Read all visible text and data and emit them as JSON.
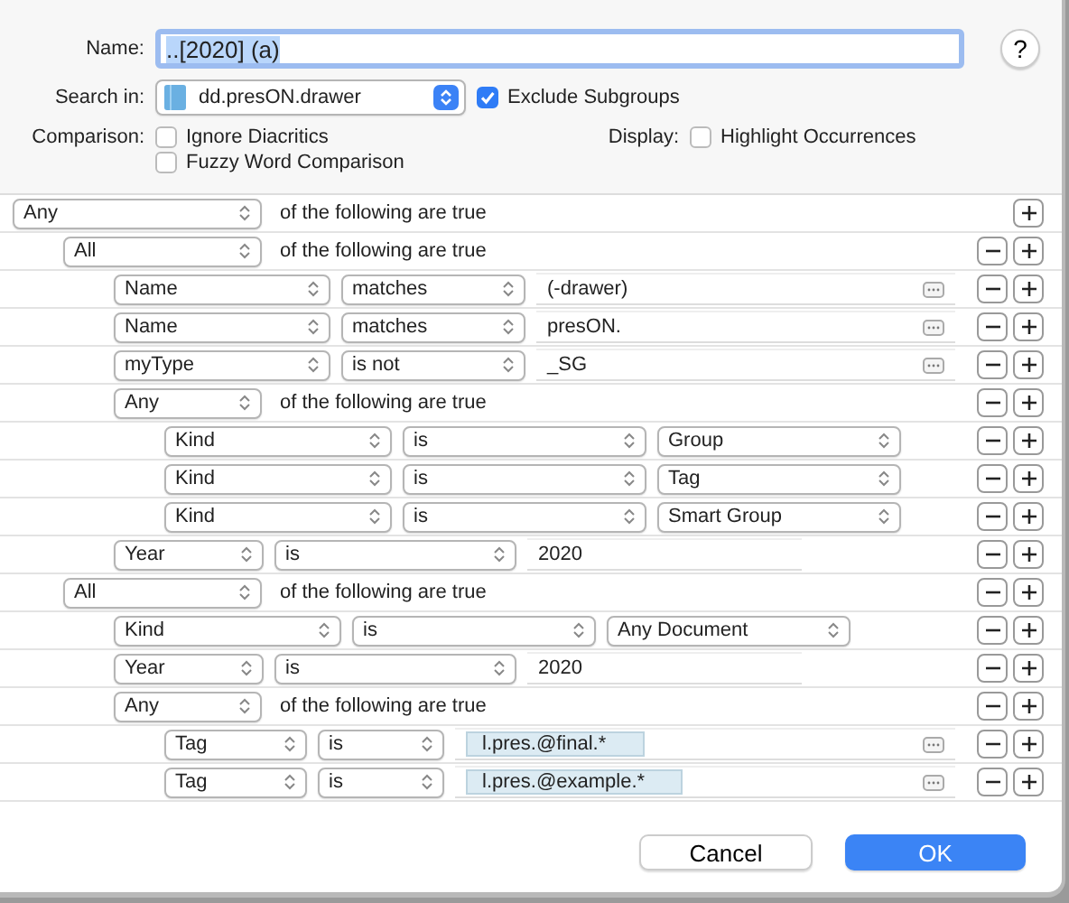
{
  "name": {
    "label": "Name:",
    "value": "..[2020] (a)"
  },
  "help": "?",
  "search_in": {
    "label": "Search in:",
    "value": "dd.presON.drawer"
  },
  "exclude_subgroups": {
    "label": "Exclude Subgroups",
    "checked": true
  },
  "comparison": {
    "label": "Comparison:",
    "options": [
      {
        "label": "Ignore Diacritics",
        "checked": false
      },
      {
        "label": "Fuzzy Word Comparison",
        "checked": false
      }
    ]
  },
  "display": {
    "label": "Display:",
    "options": [
      {
        "label": "Highlight Occurrences",
        "checked": false
      }
    ]
  },
  "rules": {
    "kind": "group",
    "quantifier": "Any",
    "suffix": "of the following are true",
    "children": [
      {
        "kind": "group",
        "quantifier": "All",
        "suffix": "of the following are true",
        "children": [
          {
            "kind": "text",
            "field": "Name",
            "operator": "matches",
            "value": "(-drawer)"
          },
          {
            "kind": "text",
            "field": "Name",
            "operator": "matches",
            "value": "presON."
          },
          {
            "kind": "text",
            "field": "myType",
            "operator": "is not",
            "value": "_SG"
          },
          {
            "kind": "group",
            "quantifier": "Any",
            "suffix": "of the following are true",
            "children": [
              {
                "kind": "choice",
                "field": "Kind",
                "operator": "is",
                "value": "Group"
              },
              {
                "kind": "choice",
                "field": "Kind",
                "operator": "is",
                "value": "Tag"
              },
              {
                "kind": "choice",
                "field": "Kind",
                "operator": "is",
                "value": "Smart Group"
              }
            ]
          },
          {
            "kind": "plain",
            "field": "Year",
            "operator": "is",
            "value": "2020"
          }
        ]
      },
      {
        "kind": "group",
        "quantifier": "All",
        "suffix": "of the following are true",
        "children": [
          {
            "kind": "choice",
            "field": "Kind",
            "operator": "is",
            "value": "Any Document"
          },
          {
            "kind": "plain",
            "field": "Year",
            "operator": "is",
            "value": "2020"
          },
          {
            "kind": "group",
            "quantifier": "Any",
            "suffix": "of the following are true",
            "children": [
              {
                "kind": "tokens",
                "field": "Tag",
                "operator": "is",
                "tokens": [
                  "l.pres.@final.*"
                ]
              },
              {
                "kind": "tokens",
                "field": "Tag",
                "operator": "is",
                "tokens": [
                  "l.pres.@example.*"
                ]
              }
            ]
          }
        ]
      }
    ]
  },
  "buttons": [
    {
      "label": "Cancel",
      "kind": "secondary"
    },
    {
      "label": "OK",
      "kind": "primary"
    }
  ]
}
